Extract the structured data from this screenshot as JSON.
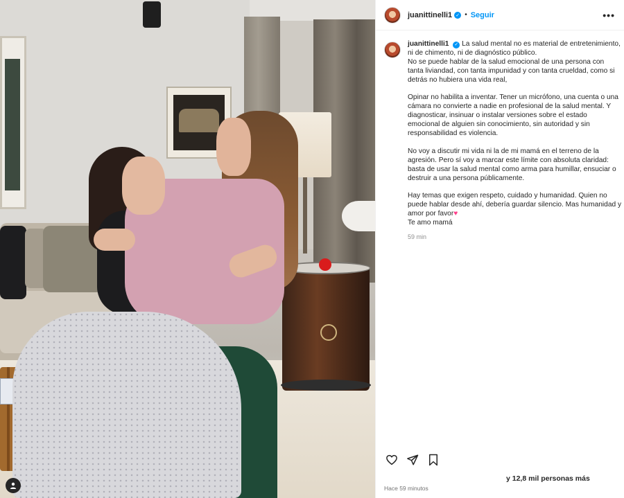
{
  "header": {
    "username": "juanittinelli1",
    "separator": "•",
    "follow_label": "Seguir",
    "more_label": "•••"
  },
  "caption": {
    "username": "juanittinelli1",
    "lines": [
      "La salud mental no es material de entretenimiento,",
      "ni de chimento, ni de diagnóstico público.",
      "No se puede hablar de la salud emocional de una persona con",
      "tanta liviandad, con tanta impunidad y con tanta crueldad, como si",
      "detrás no hubiera una vida real,",
      "",
      "Opinar no habilita a inventar. Tener un micrófono, una cuenta o una",
      "cámara no convierte a nadie en profesional de la salud mental. Y",
      "diagnosticar, insinuar o instalar versiones sobre el estado",
      "emocional de alguien sin conocimiento, sin autoridad y sin",
      "responsabilidad es violencia.",
      "",
      "No voy a discutir mi vida ni la de mi mamá en el terreno de la",
      "agresión. Pero sí voy a marcar este límite con absoluta claridad:",
      "basta de usar la salud mental como arma para humillar, ensuciar o",
      "destruir a una persona públicamente.",
      "",
      "Hay temas que exigen respeto, cuidado y humanidad. Quien no",
      "puede hablar desde ahí, debería guardar silencio. Mas humanidad y",
      "amor por favor",
      "Te amo mamá"
    ],
    "heart": "♥",
    "time": "59 min"
  },
  "footer": {
    "likes_text": "y 12,8 mil personas más",
    "time_ago": "Hace 59 minutos"
  },
  "icons": {
    "like": "heart-outline-icon",
    "share": "paper-plane-icon",
    "save": "bookmark-icon",
    "tagged": "person-tag-icon"
  },
  "colors": {
    "accent": "#0095f6",
    "text": "#262626",
    "muted": "#8e8e8e",
    "heart": "#ff3e8a"
  }
}
